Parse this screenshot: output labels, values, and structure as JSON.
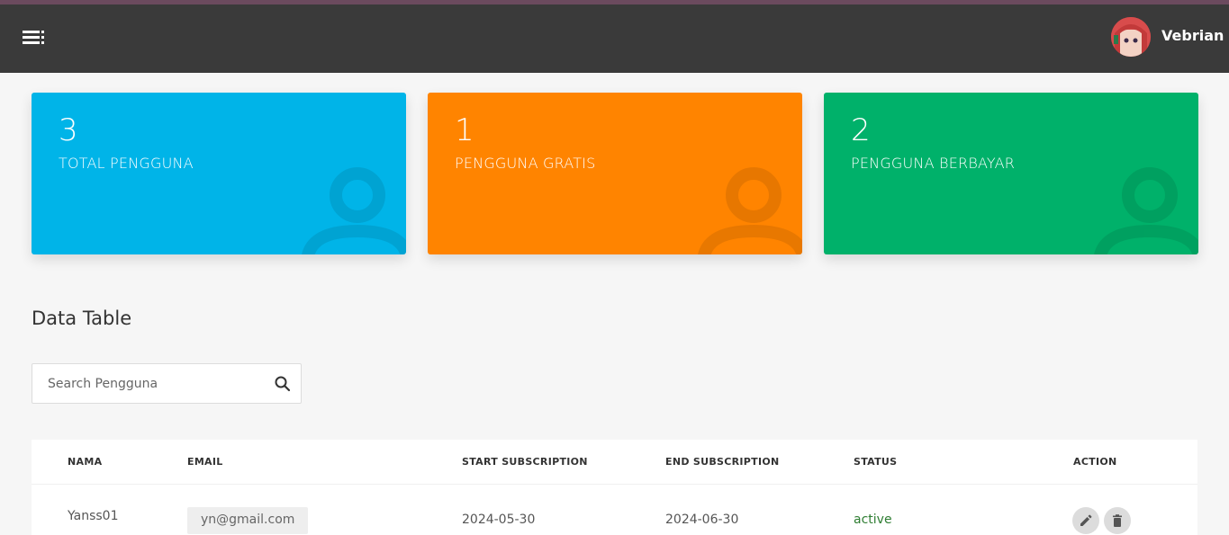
{
  "header": {
    "menu_icon": "menu-icon",
    "user_name": "Vebrian",
    "colors": {
      "bar": "#3a3a3a",
      "strip": "#6b4a5e"
    }
  },
  "stats": [
    {
      "value": "3",
      "label": "TOTAL PENGGUNA",
      "color": "#00b4e8",
      "icon": "user-icon"
    },
    {
      "value": "1",
      "label": "PENGGUNA GRATIS",
      "color": "#ff8400",
      "icon": "user-icon"
    },
    {
      "value": "2",
      "label": "PENGGUNA BERBAYAR",
      "color": "#00b16a",
      "icon": "user-icon"
    }
  ],
  "section": {
    "title": "Data Table"
  },
  "search": {
    "placeholder": "Search Pengguna",
    "value": "",
    "icon": "search-icon"
  },
  "table": {
    "columns": [
      "NAMA",
      "EMAIL",
      "START SUBSCRIPTION",
      "END SUBSCRIPTION",
      "STATUS",
      "ACTION"
    ],
    "rows": [
      {
        "nama": "Yanss01",
        "email": "yn@gmail.com",
        "start": "2024-05-30",
        "end": "2024-06-30",
        "status": "active",
        "actions": [
          "edit-icon",
          "delete-icon"
        ]
      }
    ]
  }
}
